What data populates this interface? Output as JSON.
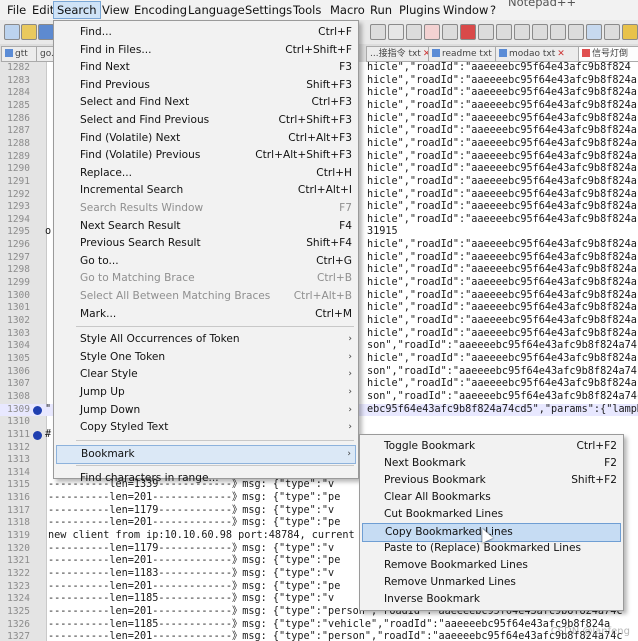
{
  "menubar": {
    "items": [
      "File",
      "Edit",
      "Search",
      "View",
      "Encoding",
      "Language",
      "Settings",
      "Tools",
      "Macro",
      "Run",
      "Plugins",
      "Window",
      "?"
    ],
    "active": "Search"
  },
  "window_title_fragment": "Notepad++",
  "tabs": [
    "gtt",
    "go...",
    "...接指令 txt",
    "readme txt",
    "modao txt",
    "信号灯倒"
  ],
  "editor": {
    "rows": [
      {
        "ln": "1282",
        "text": "hicle\",\"roadId\":\"aaeeeebc95f64e43afc9b8f824"
      },
      {
        "ln": "1283",
        "text": "hicle\",\"roadId\":\"aaeeeebc95f64e43afc9b8f824a"
      },
      {
        "ln": "1284",
        "text": "hicle\",\"roadId\":\"aaeeeebc95f64e43afc9b8f824a"
      },
      {
        "ln": "1285",
        "text": "hicle\",\"roadId\":\"aaeeeebc95f64e43afc9b8f824a"
      },
      {
        "ln": "1286",
        "text": "hicle\",\"roadId\":\"aaeeeebc95f64e43afc9b8f824a"
      },
      {
        "ln": "1287",
        "text": "hicle\",\"roadId\":\"aaeeeebc95f64e43afc9b8f824a"
      },
      {
        "ln": "1288",
        "text": "hicle\",\"roadId\":\"aaeeeebc95f64e43afc9b8f824a"
      },
      {
        "ln": "1289",
        "text": "hicle\",\"roadId\":\"aaeeeebc95f64e43afc9b8f824a"
      },
      {
        "ln": "1290",
        "text": "hicle\",\"roadId\":\"aaeeeebc95f64e43afc9b8f824a"
      },
      {
        "ln": "1291",
        "text": "hicle\",\"roadId\":\"aaeeeebc95f64e43afc9b8f824a"
      },
      {
        "ln": "1292",
        "text": "hicle\",\"roadId\":\"aaeeeebc95f64e43afc9b8f824a"
      },
      {
        "ln": "1293",
        "text": "hicle\",\"roadId\":\"aaeeeebc95f64e43afc9b8f824a"
      },
      {
        "ln": "1294",
        "text": "hicle\",\"roadId\":\"aaeeeebc95f64e43afc9b8f824a"
      },
      {
        "ln": "1295",
        "text": "31915"
      },
      {
        "ln": "1296",
        "text": "hicle\",\"roadId\":\"aaeeeebc95f64e43afc9b8f824a"
      },
      {
        "ln": "1297",
        "text": "hicle\",\"roadId\":\"aaeeeebc95f64e43afc9b8f824a"
      },
      {
        "ln": "1298",
        "text": "hicle\",\"roadId\":\"aaeeeebc95f64e43afc9b8f824a"
      },
      {
        "ln": "1299",
        "text": "hicle\",\"roadId\":\"aaeeeebc95f64e43afc9b8f824a"
      },
      {
        "ln": "1300",
        "text": "hicle\",\"roadId\":\"aaeeeebc95f64e43afc9b8f824a"
      },
      {
        "ln": "1301",
        "text": "hicle\",\"roadId\":\"aaeeeebc95f64e43afc9b8f824a"
      },
      {
        "ln": "1302",
        "text": "hicle\",\"roadId\":\"aaeeeebc95f64e43afc9b8f824a"
      },
      {
        "ln": "1303",
        "text": "hicle\",\"roadId\":\"aaeeeebc95f64e43afc9b8f824a"
      },
      {
        "ln": "1304",
        "text": "son\",\"roadId\":\"aaeeeebc95f64e43afc9b8f824a74"
      },
      {
        "ln": "1305",
        "text": "hicle\",\"roadId\":\"aaeeeebc95f64e43afc9b8f824a"
      },
      {
        "ln": "1306",
        "text": "son\",\"roadId\":\"aaeeeebc95f64e43afc9b8f824a74"
      },
      {
        "ln": "1307",
        "text": "hicle\",\"roadId\":\"aaeeeebc95f64e43afc9b8f824a"
      },
      {
        "ln": "1308",
        "text": "son\",\"roadId\":\"aaeeeebc95f64e43afc9b8f824a74c"
      },
      {
        "ln": "1309",
        "text": "ebc95f64e43afc9b8f824a74cd5\",\"params\":{\"lampD"
      },
      {
        "ln": "1310",
        "text": ""
      },
      {
        "ln": "1311",
        "text": ""
      },
      {
        "ln": "1312",
        "text": ""
      },
      {
        "ln": "1313",
        "text": ""
      },
      {
        "ln": "1314",
        "text": ""
      },
      {
        "ln": "1315",
        "text": "----------len=1339------------》msg: {\"type\":\"v"
      },
      {
        "ln": "1316",
        "text": "----------len=201-------------》msg: {\"type\":\"pe"
      },
      {
        "ln": "1317",
        "text": "----------len=1179------------》msg: {\"type\":\"v"
      },
      {
        "ln": "1318",
        "text": "----------len=201-------------》msg: {\"type\":\"pe"
      },
      {
        "ln": "1319",
        "text": "new client from ip:10.10.60.98 port:48784, current"
      },
      {
        "ln": "1320",
        "text": "----------len=1179------------》msg: {\"type\":\"v"
      },
      {
        "ln": "1321",
        "text": "----------len=201-------------》msg: {\"type\":\"pe"
      },
      {
        "ln": "1322",
        "text": "----------len=1183------------》msg: {\"type\":\"v"
      },
      {
        "ln": "1323",
        "text": "----------len=201-------------》msg: {\"type\":\"pe"
      },
      {
        "ln": "1324",
        "text": "----------len=1185------------》msg: {\"type\":\"v"
      },
      {
        "ln": "1325",
        "text": "----------len=201-------------》msg: {\"type\":\"person\",\"roadId\":\"aaeeeebc95f64e43afc9b8f824a74c"
      },
      {
        "ln": "1326",
        "text": "----------len=1185------------》msg: {\"type\":\"vehicle\",\"roadId\":\"aaeeeebc95f64e43afc9b8f824a"
      },
      {
        "ln": "1327",
        "text": "----------len=201-------------》msg: {\"type\":\"person\",\"roadId\":\"aaeeeebc95f64e43afc9b8f824a74c"
      }
    ],
    "left_fragments": {
      "1295": "o",
      "1309": "\"",
      "1311": "#"
    },
    "bookmarked_lines": [
      "1309",
      "1311"
    ],
    "current_line": "1309"
  },
  "search_menu": {
    "items": [
      {
        "label": "Find...",
        "shortcut": "Ctrl+F",
        "disabled": false
      },
      {
        "label": "Find in Files...",
        "shortcut": "Ctrl+Shift+F",
        "disabled": false
      },
      {
        "label": "Find Next",
        "shortcut": "F3",
        "disabled": false
      },
      {
        "label": "Find Previous",
        "shortcut": "Shift+F3",
        "disabled": false
      },
      {
        "label": "Select and Find Next",
        "shortcut": "Ctrl+F3",
        "disabled": false
      },
      {
        "label": "Select and Find Previous",
        "shortcut": "Ctrl+Shift+F3",
        "disabled": false
      },
      {
        "label": "Find (Volatile) Next",
        "shortcut": "Ctrl+Alt+F3",
        "disabled": false
      },
      {
        "label": "Find (Volatile) Previous",
        "shortcut": "Ctrl+Alt+Shift+F3",
        "disabled": false
      },
      {
        "label": "Replace...",
        "shortcut": "Ctrl+H",
        "disabled": false
      },
      {
        "label": "Incremental Search",
        "shortcut": "Ctrl+Alt+I",
        "disabled": false
      },
      {
        "label": "Search Results Window",
        "shortcut": "F7",
        "disabled": true
      },
      {
        "label": "Next Search Result",
        "shortcut": "F4",
        "disabled": false
      },
      {
        "label": "Previous Search Result",
        "shortcut": "Shift+F4",
        "disabled": false
      },
      {
        "label": "Go to...",
        "shortcut": "Ctrl+G",
        "disabled": false
      },
      {
        "label": "Go to Matching Brace",
        "shortcut": "Ctrl+B",
        "disabled": true
      },
      {
        "label": "Select All Between Matching Braces",
        "shortcut": "Ctrl+Alt+B",
        "disabled": true
      },
      {
        "label": "Mark...",
        "shortcut": "Ctrl+M",
        "disabled": false
      }
    ],
    "submenu_items": [
      {
        "label": "Style All Occurrences of Token"
      },
      {
        "label": "Style One Token"
      },
      {
        "label": "Clear Style"
      },
      {
        "label": "Jump Up"
      },
      {
        "label": "Jump Down"
      },
      {
        "label": "Copy Styled Text"
      }
    ],
    "bookmark": {
      "label": "Bookmark"
    },
    "find_chars": {
      "label": "Find characters in range..."
    }
  },
  "bookmark_menu": {
    "items": [
      {
        "label": "Toggle Bookmark",
        "shortcut": "Ctrl+F2"
      },
      {
        "label": "Next Bookmark",
        "shortcut": "F2"
      },
      {
        "label": "Previous Bookmark",
        "shortcut": "Shift+F2"
      },
      {
        "label": "Clear All Bookmarks",
        "shortcut": ""
      },
      {
        "label": "Cut Bookmarked Lines",
        "shortcut": ""
      },
      {
        "label": "Copy Bookmarked Lines",
        "shortcut": ""
      },
      {
        "label": "Paste to (Replace) Bookmarked Lines",
        "shortcut": ""
      },
      {
        "label": "Remove Bookmarked Lines",
        "shortcut": ""
      },
      {
        "label": "Remove Unmarked Lines",
        "shortcut": ""
      },
      {
        "label": "Inverse Bookmark",
        "shortcut": ""
      }
    ],
    "highlighted": "Copy Bookmarked Lines"
  },
  "watermark": "CSDN @lanfeng"
}
